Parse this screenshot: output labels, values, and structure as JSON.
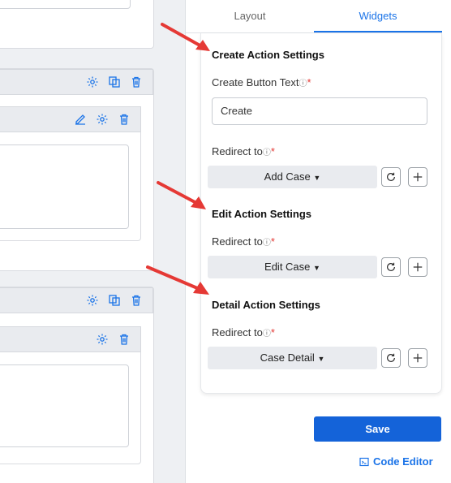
{
  "tabs": [
    "Layout",
    "Widgets"
  ],
  "create_section": {
    "title": "Create Action Settings",
    "button_text_label": "Create Button Text",
    "button_text_value": "Create",
    "redirect_label": "Redirect to",
    "redirect_value": "Add Case"
  },
  "edit_section": {
    "title": "Edit Action Settings",
    "redirect_label": "Redirect to",
    "redirect_value": "Edit Case"
  },
  "detail_section": {
    "title": "Detail Action Settings",
    "redirect_label": "Redirect to",
    "redirect_value": "Case Detail"
  },
  "footer": {
    "save_label": "Save",
    "code_editor_label": "Code Editor"
  },
  "colors": {
    "accent": "#1a73e8",
    "save_button": "#1463d9",
    "required": "#e53935",
    "annotation_arrow": "#e53935"
  }
}
